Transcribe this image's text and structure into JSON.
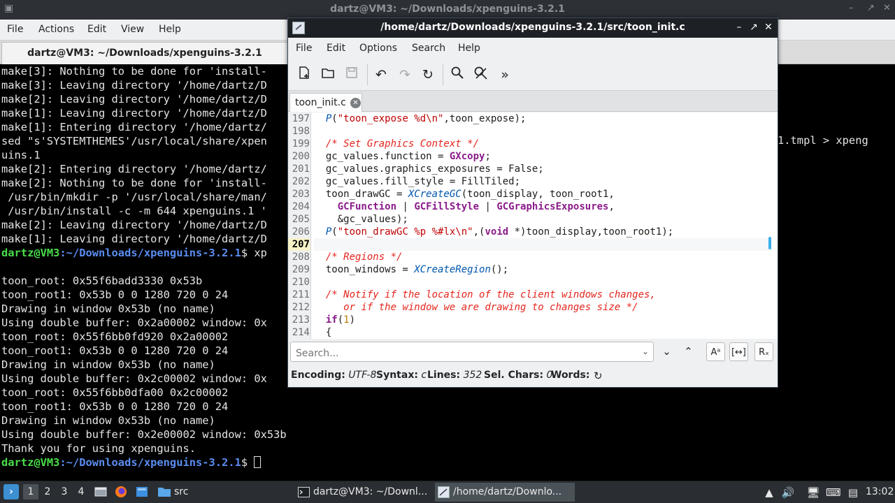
{
  "terminal": {
    "title": "dartz@VM3: ~/Downloads/xpenguins-3.2.1",
    "menu": [
      "File",
      "Actions",
      "Edit",
      "View",
      "Help"
    ],
    "tab_title": "dartz@VM3: ~/Downloads/xpenguins-3.2.1",
    "lines": [
      "make[3]: Nothing to be done for 'install-",
      "make[3]: Leaving directory '/home/dartz/D",
      "make[2]: Leaving directory '/home/dartz/D",
      "make[1]: Leaving directory '/home/dartz/D",
      "make[1]: Entering directory '/home/dartz/",
      "sed \"s'SYSTEMTHEMES'/usr/local/share/xpen",
      "uins.1",
      "make[2]: Entering directory '/home/dartz/",
      "make[2]: Nothing to be done for 'install-",
      " /usr/bin/mkdir -p '/usr/local/share/man/",
      " /usr/bin/install -c -m 644 xpenguins.1 '",
      "make[2]: Leaving directory '/home/dartz/D",
      "make[1]: Leaving directory '/home/dartz/D"
    ],
    "prompt_user": "dartz@VM3",
    "prompt_path": ":~/Downloads/xpenguins-3.2.1",
    "prompt_cmd": "$ xp",
    "lines_after": [
      "",
      "toon_root: 0x55f6badd3330 0x53b",
      "toon_root1: 0x53b 0 0 1280 720 0 24",
      "Drawing in window 0x53b (no name)",
      "Using double buffer: 0x2a00002 window: 0x",
      "toon_root: 0x55f6bb0fd920 0x2a00002",
      "toon_root1: 0x53b 0 0 1280 720 0 24",
      "Drawing in window 0x53b (no name)",
      "Using double buffer: 0x2c00002 window: 0x",
      "toon_root: 0x55f6bb0dfa00 0x2c00002",
      "toon_root1: 0x53b 0 0 1280 720 0 24",
      "Drawing in window 0x53b (no name)",
      "Using double buffer: 0x2e00002 window: 0x53b",
      "Thank you for using xpenguins."
    ],
    "final_prompt_cmd": "$ ",
    "right_fragment": "1.tmpl > xpeng"
  },
  "editor": {
    "title": "/home/dartz/Downloads/xpenguins-3.2.1/src/toon_init.c",
    "menu": [
      "File",
      "Edit",
      "Options",
      "Search",
      "Help"
    ],
    "tab_label": "toon_init.c",
    "line_numbers": [
      "197",
      "198",
      "199",
      "200",
      "201",
      "202",
      "203",
      "204",
      "205",
      "206",
      "207",
      "208",
      "209",
      "210",
      "211",
      "212",
      "213",
      "214"
    ],
    "current_line": "207",
    "code": [
      [
        [
          "  ",
          "c-plain"
        ],
        [
          "P",
          "c-func"
        ],
        [
          "(",
          "c-plain"
        ],
        [
          "\"toon_expose %d\\n\"",
          "c-str"
        ],
        [
          ",toon_expose);",
          "c-plain"
        ]
      ],
      [
        [
          "",
          "c-plain"
        ]
      ],
      [
        [
          "  ",
          "c-plain"
        ],
        [
          "/* Set Graphics Context */",
          "c-cmt"
        ]
      ],
      [
        [
          "  gc_values.function = ",
          "c-plain"
        ],
        [
          "GXcopy",
          "c-kw"
        ],
        [
          ";",
          "c-plain"
        ]
      ],
      [
        [
          "  gc_values.graphics_exposures = False;",
          "c-plain"
        ]
      ],
      [
        [
          "  gc_values.fill_style = FillTiled;",
          "c-plain"
        ]
      ],
      [
        [
          "  toon_drawGC = ",
          "c-plain"
        ],
        [
          "XCreateGC",
          "c-func"
        ],
        [
          "(toon_display, toon_root1,",
          "c-plain"
        ]
      ],
      [
        [
          "    ",
          "c-plain"
        ],
        [
          "GCFunction",
          "c-kw"
        ],
        [
          " | ",
          "c-plain"
        ],
        [
          "GCFillStyle",
          "c-kw"
        ],
        [
          " | ",
          "c-plain"
        ],
        [
          "GCGraphicsExposures",
          "c-kw"
        ],
        [
          ",",
          "c-plain"
        ]
      ],
      [
        [
          "    &gc_values);",
          "c-plain"
        ]
      ],
      [
        [
          "  ",
          "c-plain"
        ],
        [
          "P",
          "c-func"
        ],
        [
          "(",
          "c-plain"
        ],
        [
          "\"toon_drawGC %p %#lx\\n\"",
          "c-str"
        ],
        [
          ",(",
          "c-plain"
        ],
        [
          "void",
          "c-kw"
        ],
        [
          " *)toon_display,toon_root1);",
          "c-plain"
        ]
      ],
      [
        [
          "",
          "c-plain"
        ]
      ],
      [
        [
          "  ",
          "c-plain"
        ],
        [
          "/* Regions */",
          "c-cmt"
        ]
      ],
      [
        [
          "  toon_windows = ",
          "c-plain"
        ],
        [
          "XCreateRegion",
          "c-func"
        ],
        [
          "();",
          "c-plain"
        ]
      ],
      [
        [
          "",
          "c-plain"
        ]
      ],
      [
        [
          "  ",
          "c-plain"
        ],
        [
          "/* Notify if the location of the client windows changes,",
          "c-cmt"
        ]
      ],
      [
        [
          "     ",
          "c-plain"
        ],
        [
          "or if the window we are drawing to changes size */",
          "c-cmt"
        ]
      ],
      [
        [
          "  ",
          "c-plain"
        ],
        [
          "if",
          "c-kw"
        ],
        [
          "(",
          "c-plain"
        ],
        [
          "1",
          "c-num"
        ],
        [
          ")",
          "c-plain"
        ]
      ],
      [
        [
          "  {",
          "c-plain"
        ]
      ]
    ],
    "search_placeholder": "Search...",
    "status": {
      "encoding_label": "Encoding:",
      "encoding": "UTF-8",
      "syntax_label": "Syntax:",
      "syntax": "c",
      "lines_label": "Lines:",
      "lines": "352",
      "selchars_label": "Sel. Chars:",
      "selchars": "0",
      "words_label": "Words:"
    }
  },
  "taskbar": {
    "workspaces": [
      "1",
      "2",
      "3",
      "4"
    ],
    "folder_label": "src",
    "items": [
      {
        "label": "dartz@VM3: ~/Downl..."
      },
      {
        "label": "/home/dartz/Downlo..."
      }
    ],
    "clock": "13:02"
  }
}
